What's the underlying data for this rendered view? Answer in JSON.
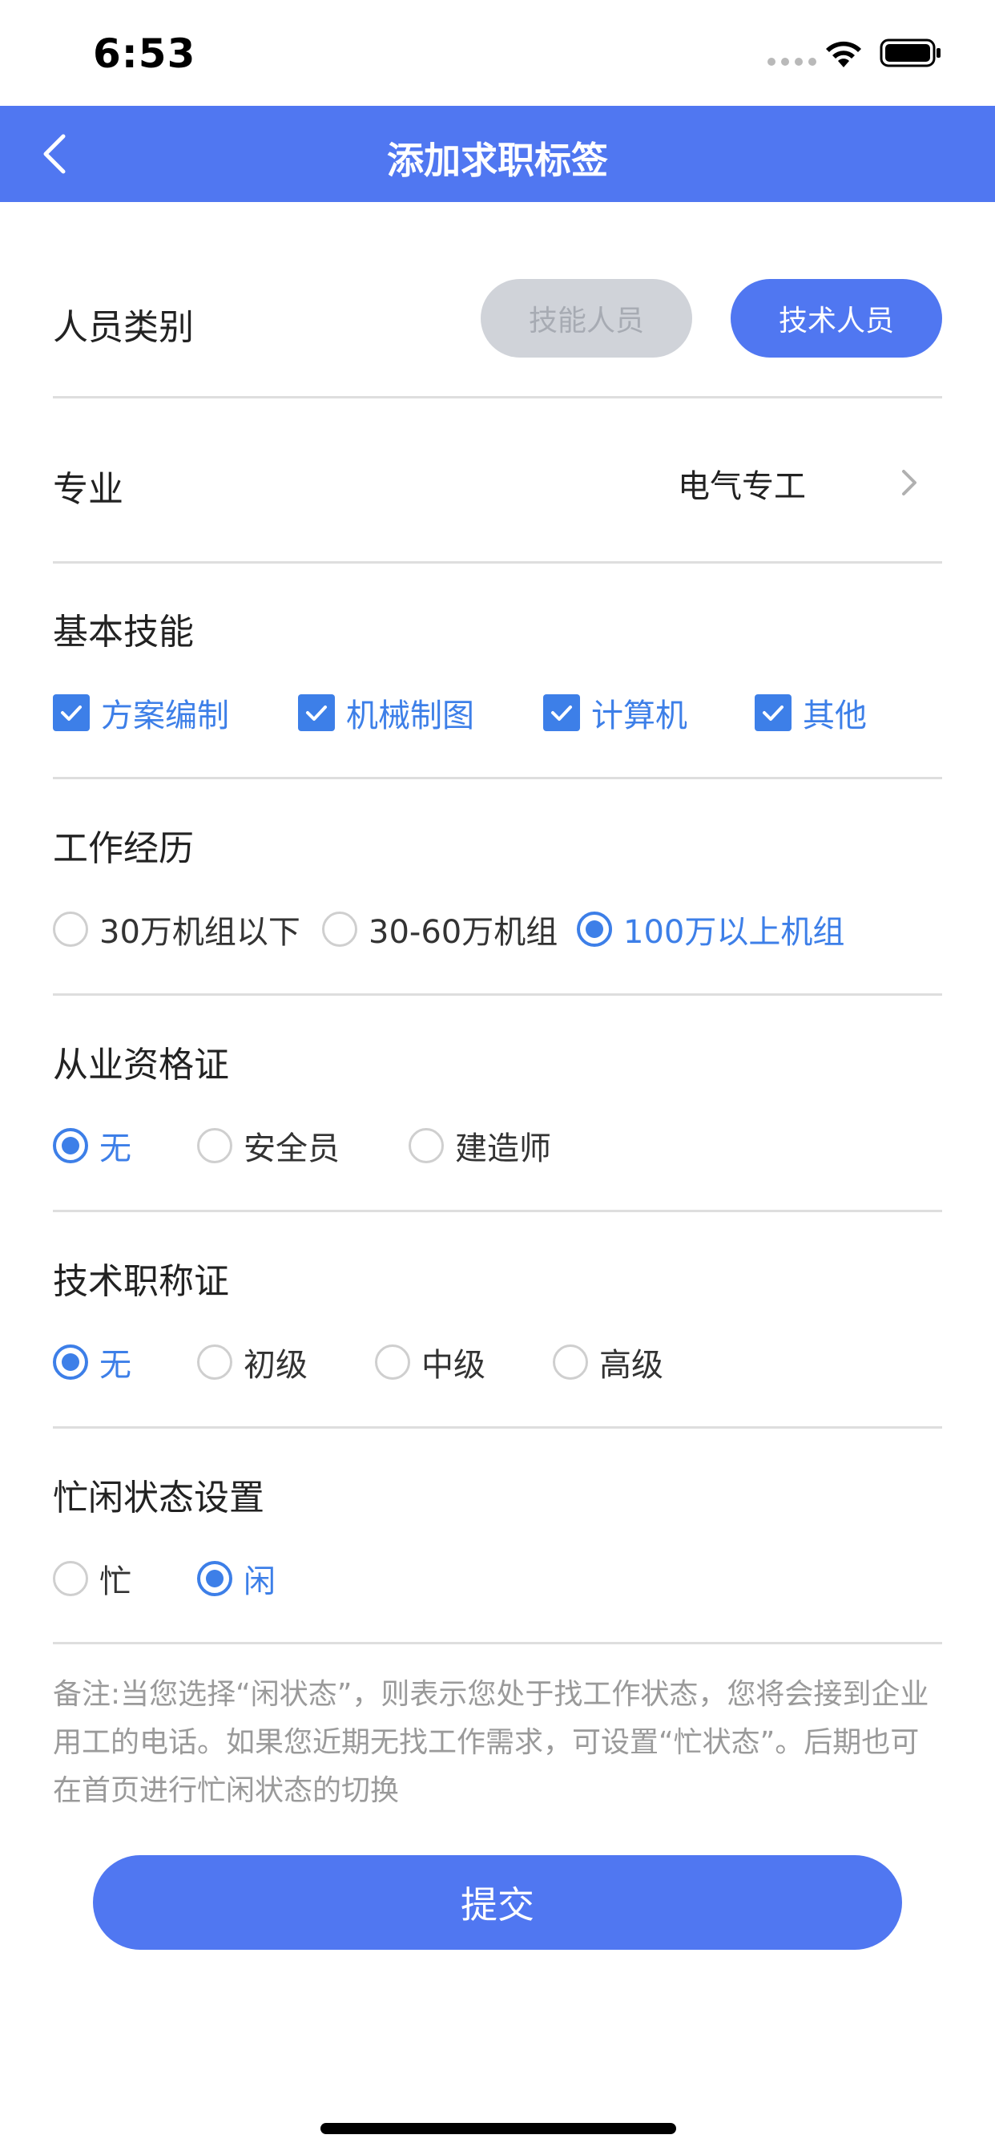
{
  "status_bar": {
    "time": "6:53"
  },
  "header": {
    "title": "添加求职标签"
  },
  "personnel_type": {
    "label": "人员类别",
    "options": [
      {
        "label": "技能人员",
        "selected": false
      },
      {
        "label": "技术人员",
        "selected": true
      }
    ]
  },
  "major": {
    "label": "专业",
    "value": "电气专工"
  },
  "basic_skills": {
    "label": "基本技能",
    "options": [
      {
        "label": "方案编制",
        "checked": true
      },
      {
        "label": "机械制图",
        "checked": true
      },
      {
        "label": "计算机",
        "checked": true
      },
      {
        "label": "其他",
        "checked": true
      }
    ]
  },
  "work_experience": {
    "label": "工作经历",
    "options": [
      {
        "label": "30万机组以下",
        "selected": false
      },
      {
        "label": "30-60万机组",
        "selected": false
      },
      {
        "label": "100万以上机组",
        "selected": true
      }
    ]
  },
  "qualification": {
    "label": "从业资格证",
    "options": [
      {
        "label": "无",
        "selected": true
      },
      {
        "label": "安全员",
        "selected": false
      },
      {
        "label": "建造师",
        "selected": false
      }
    ]
  },
  "technical_title": {
    "label": "技术职称证",
    "options": [
      {
        "label": "无",
        "selected": true
      },
      {
        "label": "初级",
        "selected": false
      },
      {
        "label": "中级",
        "selected": false
      },
      {
        "label": "高级",
        "selected": false
      }
    ]
  },
  "availability": {
    "label": "忙闲状态设置",
    "options": [
      {
        "label": "忙",
        "selected": false
      },
      {
        "label": "闲",
        "selected": true
      }
    ]
  },
  "note": "备注:当您选择“闲状态”，则表示您处于找工作状态，您将会接到企业用工的电话。如果您近期无找工作需求，可设置“忙状态”。后期也可在首页进行忙闲状态的切换",
  "submit_label": "提交",
  "colors": {
    "brand": "#5077f1",
    "accent": "#3d7fe8"
  }
}
